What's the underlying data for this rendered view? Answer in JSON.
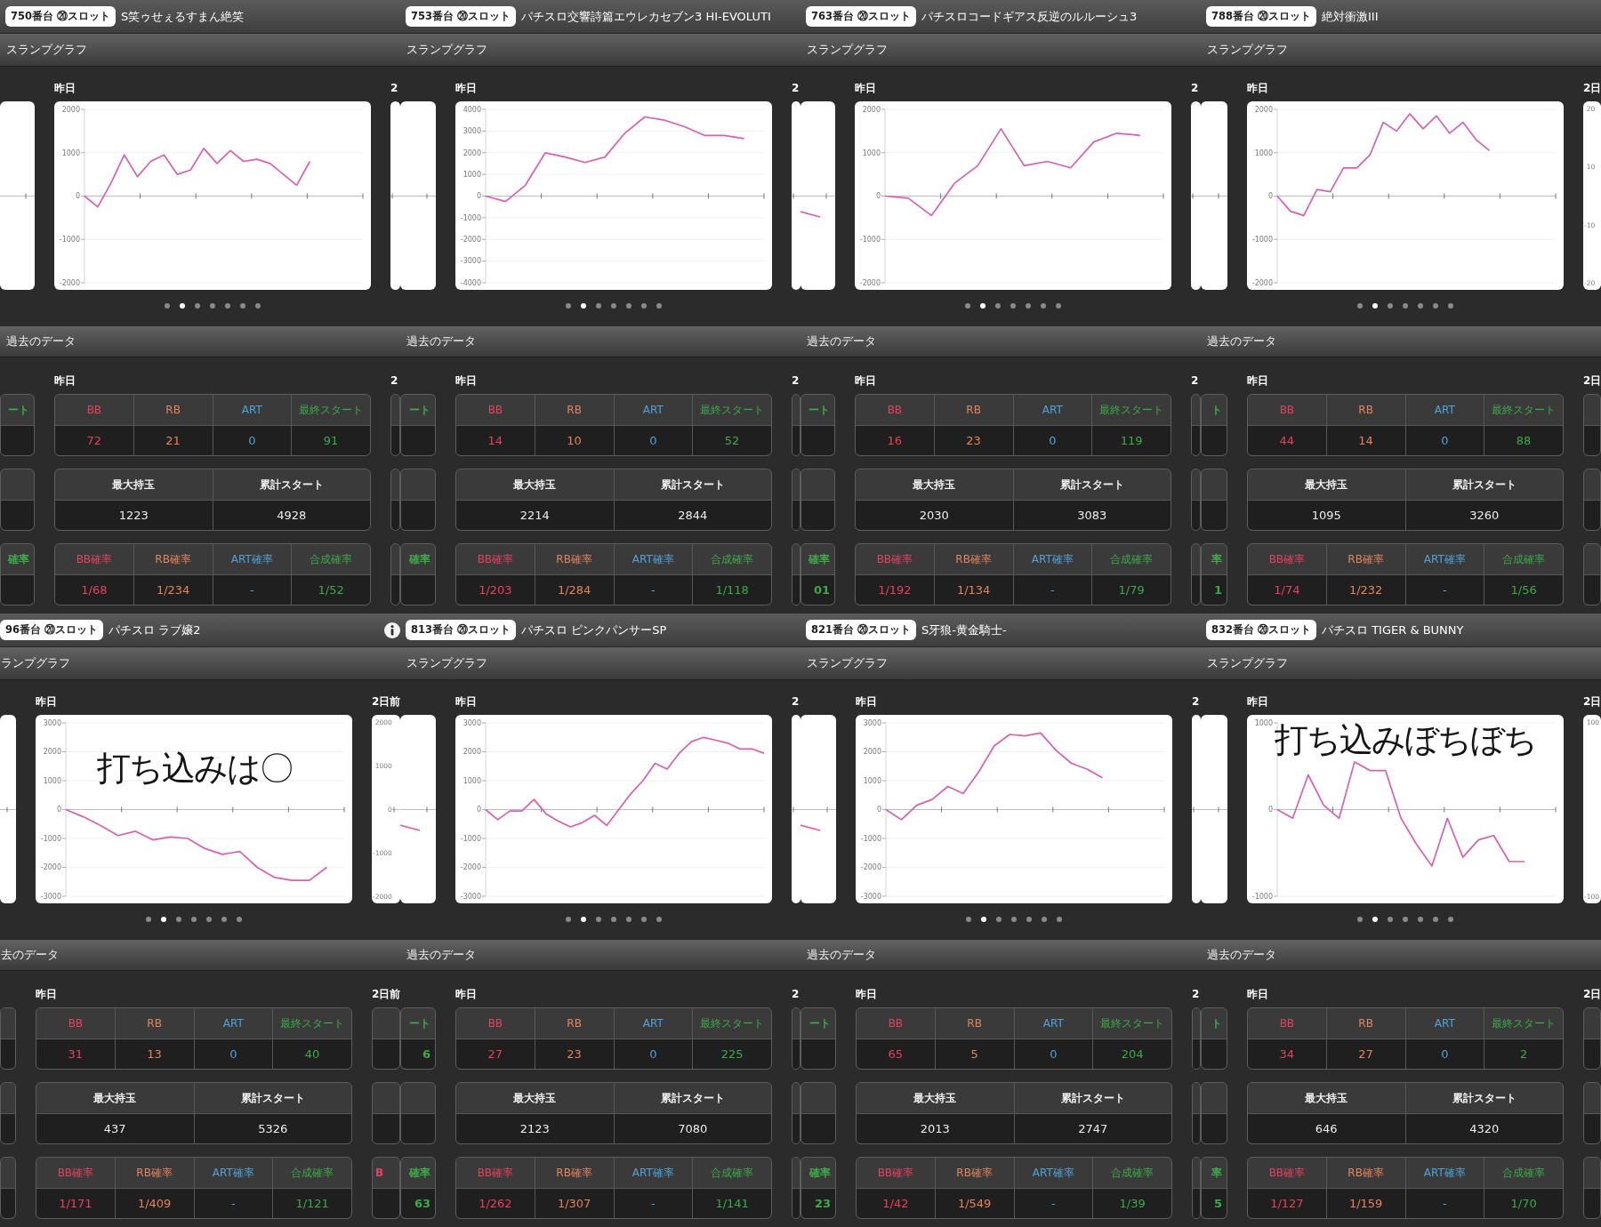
{
  "panels": [
    {
      "machine": "750番台 ⑳スロット",
      "title": "S笑ゥせぇるすまん絶笑",
      "graph": {
        "heading": "スランプグラフ",
        "label": "昨日",
        "next_label": "2",
        "chart_data": {
          "type": "line",
          "grid": true,
          "categories": [
            null,
            null,
            null,
            null,
            null,
            null,
            null,
            null,
            null,
            null,
            null,
            null,
            null,
            null,
            null,
            null,
            null,
            null,
            null,
            null,
            null,
            null
          ],
          "ylim": [
            -2000,
            2000
          ],
          "yticks": [
            2000,
            1000,
            0,
            -1000,
            -2000
          ],
          "series": [
            {
              "color": "#d95fb3",
              "values": [
                0,
                -250,
                300,
                950,
                450,
                800,
                950,
                500,
                600,
                1100,
                750,
                1050,
                800,
                850,
                750,
                500,
                250,
                800,
                null,
                null,
                null,
                null
              ]
            }
          ]
        },
        "pages": [
          {
            "selected": false
          },
          {
            "selected": true
          },
          {
            "selected": false
          },
          {
            "selected": false
          },
          {
            "selected": false
          },
          {
            "selected": false
          },
          {
            "selected": false
          }
        ]
      },
      "history": {
        "heading": "過去のデータ",
        "label": "昨日",
        "next_label": "2",
        "tables": [
          {
            "columns": [
              {
                "label": "BB",
                "value": "72",
                "color": "#e8415f"
              },
              {
                "label": "RB",
                "value": "21",
                "color": "#e3855b"
              },
              {
                "label": "ART",
                "value": "0",
                "color": "#4fa3d8"
              },
              {
                "label": "最終スタート",
                "value": "91",
                "color": "#3caa48"
              }
            ]
          },
          {
            "columns": [
              {
                "label": "最大持玉",
                "value": "1223"
              },
              {
                "label": "累計スタート",
                "value": "4928"
              }
            ]
          },
          {
            "columns": [
              {
                "label": "BB確率",
                "value": "1/68",
                "color": "#e8415f"
              },
              {
                "label": "RB確率",
                "value": "1/234",
                "color": "#e3855b"
              },
              {
                "label": "ART確率",
                "value": "-",
                "color": "#4fa3d8"
              },
              {
                "label": "合成確率",
                "value": "1/52",
                "color": "#3caa48"
              }
            ]
          }
        ],
        "prev_cells": [
          {
            "kind": "counts",
            "header": "ート",
            "color": "#3caa48"
          },
          {
            "kind": "rates",
            "header": "確率",
            "color": "#3caa48"
          }
        ]
      }
    },
    {
      "machine": "753番台 ⑳スロット",
      "title": "パチスロ交響詩篇エウレカセブン3 HI-EVOLUTI",
      "graph": {
        "heading": "スランプグラフ",
        "label": "昨日",
        "next_label": "2",
        "chart_data": {
          "type": "line",
          "grid": true,
          "categories": [
            null,
            null,
            null,
            null,
            null,
            null,
            null,
            null,
            null,
            null,
            null,
            null,
            null,
            null,
            null
          ],
          "ylim": [
            -4000,
            4000
          ],
          "yticks": [
            4000,
            3000,
            2000,
            1000,
            0,
            -1000,
            -2000,
            -3000,
            -4000
          ],
          "series": [
            {
              "color": "#d95fb3",
              "values": [
                0,
                -250,
                500,
                2000,
                1800,
                1550,
                1800,
                2900,
                3650,
                3500,
                3200,
                2800,
                2800,
                2650,
                null
              ]
            }
          ]
        },
        "pages": [
          {
            "selected": false
          },
          {
            "selected": true
          },
          {
            "selected": false
          },
          {
            "selected": false
          },
          {
            "selected": false
          },
          {
            "selected": false
          },
          {
            "selected": false
          }
        ]
      },
      "history": {
        "heading": "過去のデータ",
        "label": "昨日",
        "next_label": "2",
        "tables": [
          {
            "columns": [
              {
                "label": "BB",
                "value": "14",
                "color": "#e8415f"
              },
              {
                "label": "RB",
                "value": "10",
                "color": "#e3855b"
              },
              {
                "label": "ART",
                "value": "0",
                "color": "#4fa3d8"
              },
              {
                "label": "最終スタート",
                "value": "52",
                "color": "#3caa48"
              }
            ]
          },
          {
            "columns": [
              {
                "label": "最大持玉",
                "value": "2214"
              },
              {
                "label": "累計スタート",
                "value": "2844"
              }
            ]
          },
          {
            "columns": [
              {
                "label": "BB確率",
                "value": "1/203",
                "color": "#e8415f"
              },
              {
                "label": "RB確率",
                "value": "1/284",
                "color": "#e3855b"
              },
              {
                "label": "ART確率",
                "value": "-",
                "color": "#4fa3d8"
              },
              {
                "label": "合成確率",
                "value": "1/118",
                "color": "#3caa48"
              }
            ]
          }
        ],
        "prev_cells": [
          {
            "kind": "counts",
            "header": "ート",
            "color": "#3caa48"
          },
          {
            "kind": "rates",
            "header": "確率",
            "color": "#3caa48"
          }
        ]
      }
    },
    {
      "machine": "763番台 ⑳スロット",
      "title": "パチスロコードギアス反逆のルルーシュ3",
      "graph": {
        "heading": "スランプグラフ",
        "label": "昨日",
        "next_label": "2",
        "prev_line": true,
        "chart_data": {
          "type": "line",
          "grid": true,
          "categories": [
            null,
            null,
            null,
            null,
            null,
            null,
            null,
            null,
            null,
            null,
            null,
            null,
            null
          ],
          "ylim": [
            -2000,
            2000
          ],
          "yticks": [
            2000,
            1000,
            0,
            -1000,
            -2000
          ],
          "series": [
            {
              "color": "#d95fb3",
              "values": [
                0,
                -50,
                -450,
                300,
                700,
                1550,
                700,
                800,
                650,
                1250,
                1450,
                1400,
                null
              ]
            }
          ]
        },
        "pages": [
          {
            "selected": false
          },
          {
            "selected": true
          },
          {
            "selected": false
          },
          {
            "selected": false
          },
          {
            "selected": false
          },
          {
            "selected": false
          },
          {
            "selected": false
          }
        ]
      },
      "history": {
        "heading": "過去のデータ",
        "label": "昨日",
        "next_label": "2",
        "tables": [
          {
            "columns": [
              {
                "label": "BB",
                "value": "16",
                "color": "#e8415f"
              },
              {
                "label": "RB",
                "value": "23",
                "color": "#e3855b"
              },
              {
                "label": "ART",
                "value": "0",
                "color": "#4fa3d8"
              },
              {
                "label": "最終スタート",
                "value": "119",
                "color": "#3caa48"
              }
            ]
          },
          {
            "columns": [
              {
                "label": "最大持玉",
                "value": "2030"
              },
              {
                "label": "累計スタート",
                "value": "3083"
              }
            ]
          },
          {
            "columns": [
              {
                "label": "BB確率",
                "value": "1/192",
                "color": "#e8415f"
              },
              {
                "label": "RB確率",
                "value": "1/134",
                "color": "#e3855b"
              },
              {
                "label": "ART確率",
                "value": "-",
                "color": "#4fa3d8"
              },
              {
                "label": "合成確率",
                "value": "1/79",
                "color": "#3caa48"
              }
            ]
          }
        ],
        "prev_cells": [
          {
            "kind": "counts",
            "header": "ート",
            "color": "#3caa48"
          },
          {
            "kind": "rates",
            "header": "確率",
            "value": "01",
            "color": "#3caa48"
          }
        ]
      }
    },
    {
      "machine": "788番台 ⑳スロット",
      "title": "絶対衝激III",
      "graph": {
        "heading": "スランプグラフ",
        "label": "昨日",
        "next_label": "2日",
        "next_ticks": [
          "20",
          "10",
          "-10",
          "-20"
        ],
        "chart_data": {
          "type": "line",
          "grid": true,
          "categories": [
            null,
            null,
            null,
            null,
            null,
            null,
            null,
            null,
            null,
            null,
            null,
            null,
            null,
            null,
            null,
            null,
            null,
            null,
            null,
            null,
            null,
            null
          ],
          "ylim": [
            -2000,
            2000
          ],
          "yticks": [
            2000,
            1000,
            0,
            -1000,
            -2000
          ],
          "series": [
            {
              "color": "#d95fb3",
              "values": [
                0,
                -350,
                -450,
                150,
                100,
                650,
                650,
                950,
                1700,
                1500,
                1900,
                1550,
                1850,
                1450,
                1700,
                1300,
                1050,
                null,
                null,
                null,
                null,
                null
              ]
            }
          ]
        },
        "pages": [
          {
            "selected": false
          },
          {
            "selected": true
          },
          {
            "selected": false
          },
          {
            "selected": false
          },
          {
            "selected": false
          },
          {
            "selected": false
          },
          {
            "selected": false
          }
        ]
      },
      "history": {
        "heading": "過去のデータ",
        "label": "昨日",
        "next_label": "2日",
        "tables": [
          {
            "columns": [
              {
                "label": "BB",
                "value": "44",
                "color": "#e8415f"
              },
              {
                "label": "RB",
                "value": "14",
                "color": "#e3855b"
              },
              {
                "label": "ART",
                "value": "0",
                "color": "#4fa3d8"
              },
              {
                "label": "最終スタート",
                "value": "88",
                "color": "#3caa48"
              }
            ]
          },
          {
            "columns": [
              {
                "label": "最大持玉",
                "value": "1095"
              },
              {
                "label": "累計スタート",
                "value": "3260"
              }
            ]
          },
          {
            "columns": [
              {
                "label": "BB確率",
                "value": "1/74",
                "color": "#e8415f"
              },
              {
                "label": "RB確率",
                "value": "1/232",
                "color": "#e3855b"
              },
              {
                "label": "ART確率",
                "value": "-",
                "color": "#4fa3d8"
              },
              {
                "label": "合成確率",
                "value": "1/56",
                "color": "#3caa48"
              }
            ]
          }
        ],
        "prev_cells": [
          {
            "kind": "counts",
            "header": "ト",
            "color": "#3caa48"
          },
          {
            "kind": "rates",
            "header": "率",
            "value": "1",
            "color": "#3caa48"
          }
        ]
      }
    },
    {
      "machine": "96番台 ⑳スロット",
      "title": "パチスロ ラブ嬢2",
      "info": true,
      "graph": {
        "heading": "ランプグラフ",
        "label": "昨日",
        "next_label": "2日前",
        "next_ticks": [
          "2000",
          "1000",
          "0",
          "-1000",
          "-2000"
        ],
        "note": "打ち込みは〇",
        "chart_data": {
          "type": "line",
          "grid": true,
          "categories": [
            null,
            null,
            null,
            null,
            null,
            null,
            null,
            null,
            null,
            null,
            null,
            null,
            null,
            null,
            null,
            null,
            null
          ],
          "ylim": [
            -3000,
            3000
          ],
          "yticks": [
            3000,
            2000,
            1000,
            0,
            -1000,
            -2000,
            -3000
          ],
          "series": [
            {
              "color": "#d95fb3",
              "values": [
                0,
                -250,
                -550,
                -900,
                -750,
                -1050,
                -950,
                -1000,
                -1350,
                -1550,
                -1450,
                -2000,
                -2350,
                -2450,
                -2450,
                -2000,
                null
              ]
            }
          ]
        },
        "pages": [
          {
            "selected": false
          },
          {
            "selected": true
          },
          {
            "selected": false
          },
          {
            "selected": false
          },
          {
            "selected": false
          },
          {
            "selected": false
          },
          {
            "selected": false
          }
        ]
      },
      "history": {
        "heading": "去のデータ",
        "label": "昨日",
        "next_label": "2日前",
        "tables": [
          {
            "columns": [
              {
                "label": "BB",
                "value": "31",
                "color": "#e8415f"
              },
              {
                "label": "RB",
                "value": "13",
                "color": "#e3855b"
              },
              {
                "label": "ART",
                "value": "0",
                "color": "#4fa3d8"
              },
              {
                "label": "最終スタート",
                "value": "40",
                "color": "#3caa48"
              }
            ]
          },
          {
            "columns": [
              {
                "label": "最大持玉",
                "value": "437"
              },
              {
                "label": "累計スタート",
                "value": "5326"
              }
            ]
          },
          {
            "columns": [
              {
                "label": "BB確率",
                "value": "1/171",
                "color": "#e8415f"
              },
              {
                "label": "RB確率",
                "value": "1/409",
                "color": "#e3855b"
              },
              {
                "label": "ART確率",
                "value": "-",
                "color": "#4fa3d8"
              },
              {
                "label": "合成確率",
                "value": "1/121",
                "color": "#3caa48"
              }
            ]
          }
        ],
        "next_cells": [
          {
            "kind": "rates",
            "header": "B",
            "color": "#e8415f"
          }
        ]
      }
    },
    {
      "machine": "813番台 ⑳スロット",
      "title": "パチスロ ピンクパンサーSP",
      "graph": {
        "heading": "スランプグラフ",
        "label": "昨日",
        "next_label": "2",
        "prev_line": true,
        "chart_data": {
          "type": "line",
          "grid": true,
          "categories": [
            null,
            null,
            null,
            null,
            null,
            null,
            null,
            null,
            null,
            null,
            null,
            null,
            null,
            null,
            null,
            null,
            null,
            null,
            null,
            null,
            null,
            null,
            null,
            null
          ],
          "ylim": [
            -3000,
            3000
          ],
          "yticks": [
            3000,
            2000,
            1000,
            0,
            -1000,
            -2000,
            -3000
          ],
          "series": [
            {
              "color": "#d95fb3",
              "values": [
                0,
                -350,
                -50,
                -50,
                350,
                -150,
                -400,
                -600,
                -450,
                -200,
                -550,
                0,
                550,
                1000,
                1600,
                1400,
                1950,
                2350,
                2500,
                2400,
                2300,
                2100,
                2100,
                1950
              ]
            }
          ]
        },
        "pages": [
          {
            "selected": false
          },
          {
            "selected": true
          },
          {
            "selected": false
          },
          {
            "selected": false
          },
          {
            "selected": false
          },
          {
            "selected": false
          },
          {
            "selected": false
          }
        ]
      },
      "history": {
        "heading": "過去のデータ",
        "label": "昨日",
        "next_label": "2",
        "tables": [
          {
            "columns": [
              {
                "label": "BB",
                "value": "27",
                "color": "#e8415f"
              },
              {
                "label": "RB",
                "value": "23",
                "color": "#e3855b"
              },
              {
                "label": "ART",
                "value": "0",
                "color": "#4fa3d8"
              },
              {
                "label": "最終スタート",
                "value": "225",
                "color": "#3caa48"
              }
            ]
          },
          {
            "columns": [
              {
                "label": "最大持玉",
                "value": "2123"
              },
              {
                "label": "累計スタート",
                "value": "7080"
              }
            ]
          },
          {
            "columns": [
              {
                "label": "BB確率",
                "value": "1/262",
                "color": "#e8415f"
              },
              {
                "label": "RB確率",
                "value": "1/307",
                "color": "#e3855b"
              },
              {
                "label": "ART確率",
                "value": "-",
                "color": "#4fa3d8"
              },
              {
                "label": "合成確率",
                "value": "1/141",
                "color": "#3caa48"
              }
            ]
          }
        ],
        "prev_cells": [
          {
            "kind": "counts",
            "header": "ート",
            "value": "6",
            "color": "#3caa48"
          },
          {
            "kind": "rates",
            "header": "確率",
            "value": "63",
            "color": "#3caa48"
          }
        ]
      }
    },
    {
      "machine": "821番台 ⑳スロット",
      "title": "S牙狼-黄金騎士-",
      "graph": {
        "heading": "スランプグラフ",
        "label": "昨日",
        "next_label": "2",
        "prev_line": true,
        "chart_data": {
          "type": "line",
          "grid": true,
          "categories": [
            null,
            null,
            null,
            null,
            null,
            null,
            null,
            null,
            null,
            null,
            null,
            null,
            null,
            null,
            null,
            null,
            null,
            null,
            null
          ],
          "ylim": [
            -3000,
            3000
          ],
          "yticks": [
            3000,
            2000,
            1000,
            0,
            -1000,
            -2000,
            -3000
          ],
          "series": [
            {
              "color": "#d95fb3",
              "values": [
                0,
                -350,
                150,
                350,
                800,
                550,
                1300,
                2200,
                2600,
                2550,
                2650,
                2050,
                1600,
                1400,
                1100,
                null,
                null,
                null,
                null
              ]
            }
          ]
        },
        "pages": [
          {
            "selected": false
          },
          {
            "selected": true
          },
          {
            "selected": false
          },
          {
            "selected": false
          },
          {
            "selected": false
          },
          {
            "selected": false
          },
          {
            "selected": false
          }
        ]
      },
      "history": {
        "heading": "過去のデータ",
        "label": "昨日",
        "next_label": "2",
        "tables": [
          {
            "columns": [
              {
                "label": "BB",
                "value": "65",
                "color": "#e8415f"
              },
              {
                "label": "RB",
                "value": "5",
                "color": "#e3855b"
              },
              {
                "label": "ART",
                "value": "0",
                "color": "#4fa3d8"
              },
              {
                "label": "最終スタート",
                "value": "204",
                "color": "#3caa48"
              }
            ]
          },
          {
            "columns": [
              {
                "label": "最大持玉",
                "value": "2013"
              },
              {
                "label": "累計スタート",
                "value": "2747"
              }
            ]
          },
          {
            "columns": [
              {
                "label": "BB確率",
                "value": "1/42",
                "color": "#e8415f"
              },
              {
                "label": "RB確率",
                "value": "1/549",
                "color": "#e3855b"
              },
              {
                "label": "ART確率",
                "value": "-",
                "color": "#4fa3d8"
              },
              {
                "label": "合成確率",
                "value": "1/39",
                "color": "#3caa48"
              }
            ]
          }
        ],
        "prev_cells": [
          {
            "kind": "counts",
            "header": "ート",
            "color": "#3caa48"
          },
          {
            "kind": "rates",
            "header": "確率",
            "value": "23",
            "color": "#3caa48"
          }
        ]
      }
    },
    {
      "machine": "832番台 ⑳スロット",
      "title": "パチスロ TIGER & BUNNY",
      "graph": {
        "heading": "スランプグラフ",
        "label": "昨日",
        "next_label": "2日",
        "next_ticks": [
          "100",
          "-100"
        ],
        "note": "打ち込みぼちぼち",
        "chart_data": {
          "type": "line",
          "grid": true,
          "categories": [
            null,
            null,
            null,
            null,
            null,
            null,
            null,
            null,
            null,
            null,
            null,
            null,
            null,
            null,
            null,
            null,
            null,
            null,
            null
          ],
          "ylim": [
            -1000,
            1000
          ],
          "yticks": [
            1000,
            0,
            -1000
          ],
          "series": [
            {
              "color": "#d95fb3",
              "values": [
                0,
                -100,
                400,
                50,
                -100,
                550,
                450,
                450,
                -100,
                -400,
                -650,
                -100,
                -550,
                -350,
                -300,
                -600,
                -600,
                null,
                null
              ]
            }
          ]
        },
        "pages": [
          {
            "selected": false
          },
          {
            "selected": true
          },
          {
            "selected": false
          },
          {
            "selected": false
          },
          {
            "selected": false
          },
          {
            "selected": false
          },
          {
            "selected": false
          }
        ]
      },
      "history": {
        "heading": "過去のデータ",
        "label": "昨日",
        "next_label": "2日",
        "tables": [
          {
            "columns": [
              {
                "label": "BB",
                "value": "34",
                "color": "#e8415f"
              },
              {
                "label": "RB",
                "value": "27",
                "color": "#e3855b"
              },
              {
                "label": "ART",
                "value": "0",
                "color": "#4fa3d8"
              },
              {
                "label": "最終スタート",
                "value": "2",
                "color": "#3caa48"
              }
            ]
          },
          {
            "columns": [
              {
                "label": "最大持玉",
                "value": "646"
              },
              {
                "label": "累計スタート",
                "value": "4320"
              }
            ]
          },
          {
            "columns": [
              {
                "label": "BB確率",
                "value": "1/127",
                "color": "#e8415f"
              },
              {
                "label": "RB確率",
                "value": "1/159",
                "color": "#e3855b"
              },
              {
                "label": "ART確率",
                "value": "-",
                "color": "#4fa3d8"
              },
              {
                "label": "合成確率",
                "value": "1/70",
                "color": "#3caa48"
              }
            ]
          }
        ],
        "prev_cells": [
          {
            "kind": "counts",
            "header": "ト",
            "color": "#3caa48"
          },
          {
            "kind": "rates",
            "header": "率",
            "value": "5",
            "color": "#3caa48"
          }
        ]
      }
    }
  ]
}
